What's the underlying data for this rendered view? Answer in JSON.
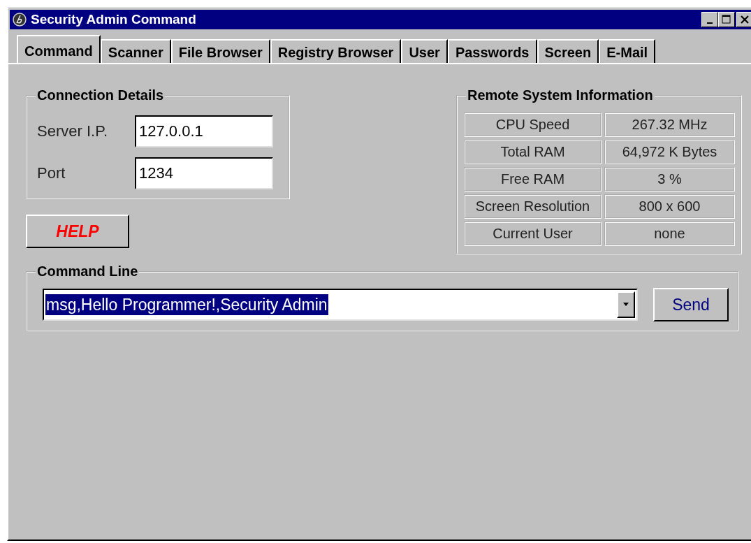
{
  "window": {
    "title": "Security Admin Command"
  },
  "tabs": [
    {
      "label": "Command",
      "selected": true
    },
    {
      "label": "Scanner",
      "selected": false
    },
    {
      "label": "File Browser",
      "selected": false
    },
    {
      "label": "Registry Browser",
      "selected": false
    },
    {
      "label": "User",
      "selected": false
    },
    {
      "label": "Passwords",
      "selected": false
    },
    {
      "label": "Screen",
      "selected": false
    },
    {
      "label": "E-Mail",
      "selected": false
    }
  ],
  "connection_details": {
    "title": "Connection Details",
    "fields": [
      {
        "label": "Server I.P.",
        "value": "127.0.0.1"
      },
      {
        "label": "Port",
        "value": "1234"
      }
    ]
  },
  "help_button": {
    "label": "HELP"
  },
  "remote_system_information": {
    "title": "Remote System Information",
    "rows": [
      {
        "label": "CPU Speed",
        "value": "267.32 MHz"
      },
      {
        "label": "Total RAM",
        "value": "64,972 K Bytes"
      },
      {
        "label": "Free RAM",
        "value": "3 %"
      },
      {
        "label": "Screen Resolution",
        "value": "800 x 600"
      },
      {
        "label": "Current User",
        "value": "none"
      }
    ]
  },
  "command_line": {
    "title": "Command Line",
    "value": "msg,Hello Programmer!,Security Admin",
    "highlighted": true,
    "send_button": "Send"
  }
}
